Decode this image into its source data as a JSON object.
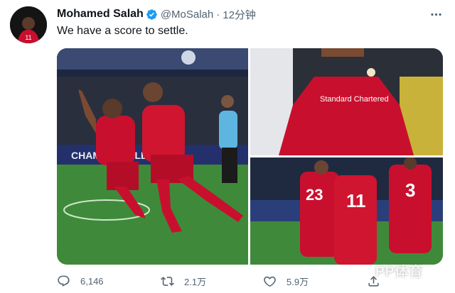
{
  "tweet": {
    "author_name": "Mohamed Salah",
    "handle": "@MoSalah",
    "separator": "·",
    "time": "12分钟",
    "text": "We have a score to settle."
  },
  "actions": {
    "replies": "6,146",
    "retweets": "2.1万",
    "likes": "5.9万"
  },
  "photos": {
    "banner_text": "CHAMPIONS LEAGUE",
    "sponsor_text": "Standard Chartered",
    "player_1_number": "23",
    "player_2_number": "11",
    "player_3_number": "3"
  },
  "watermark": "PP体育",
  "colors": {
    "accent_blue": "#1d9bf0",
    "liverpool_red": "#c8102e",
    "pitch_green": "#2e7d32",
    "muted_text": "#536471"
  },
  "icons": {
    "verified": "verified-badge-icon",
    "more": "more-options-icon",
    "reply": "reply-icon",
    "retweet": "retweet-icon",
    "like": "like-icon",
    "share": "share-icon"
  }
}
